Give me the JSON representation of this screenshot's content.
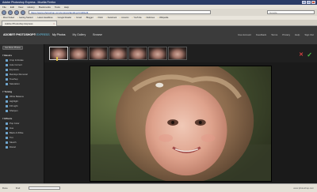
{
  "window": {
    "title": "Adobe Photoshop Express - Mozilla Firefox"
  },
  "menu": [
    "File",
    "Edit",
    "View",
    "History",
    "Bookmarks",
    "Tools",
    "Help"
  ],
  "nav": {
    "url": "https://www.photoshop.com/express/landing.html#/edit",
    "search_placeholder": "Google"
  },
  "bookmarks": [
    "Most Visited",
    "Getting Started",
    "Latest Headlines",
    "Google Reader",
    "Gmail",
    "Blogger",
    "Flickr",
    "Facebook",
    "Amazon",
    "YouTube",
    "Delicious",
    "Wikipedia"
  ],
  "tab": {
    "label": "Adobe Photoshop Express",
    "close_icon": "close-icon"
  },
  "app": {
    "logo_main": "ADOBE® PHOTOSHOP®",
    "logo_sub": "EXPRESS",
    "topnav": [
      "My Photos",
      "My Gallery",
      "Browse"
    ],
    "account": [
      "Use Account",
      "Feedback",
      "Terms",
      "Privacy",
      "Help",
      "Sign Out"
    ]
  },
  "sidebar": {
    "get_more": "Get More Photos",
    "groups": [
      {
        "title": "Basics",
        "items": [
          "Crop & Rotate",
          "Auto Correct",
          "Exposure",
          "Red-Eye Removal",
          "Touchup",
          "Saturation"
        ]
      },
      {
        "title": "Tuning",
        "items": [
          "White Balance",
          "Highlight",
          "Fill Light",
          "Sharpen"
        ]
      },
      {
        "title": "Effects",
        "items": [
          "Pop Color",
          "Hue",
          "Black & White",
          "Tint",
          "Sketch",
          "Distort"
        ]
      }
    ]
  },
  "filmstrip": {
    "count": 7,
    "selected_index": 0,
    "ok_icon": "checkmark-icon",
    "cancel_icon": "cancel-icon"
  },
  "status": {
    "left": "Done",
    "find_label": "Find:",
    "right": "www.photoshop.com"
  },
  "colors": {
    "accent": "#67c6e8",
    "ok": "#4fc24a",
    "cancel": "#d64040"
  }
}
